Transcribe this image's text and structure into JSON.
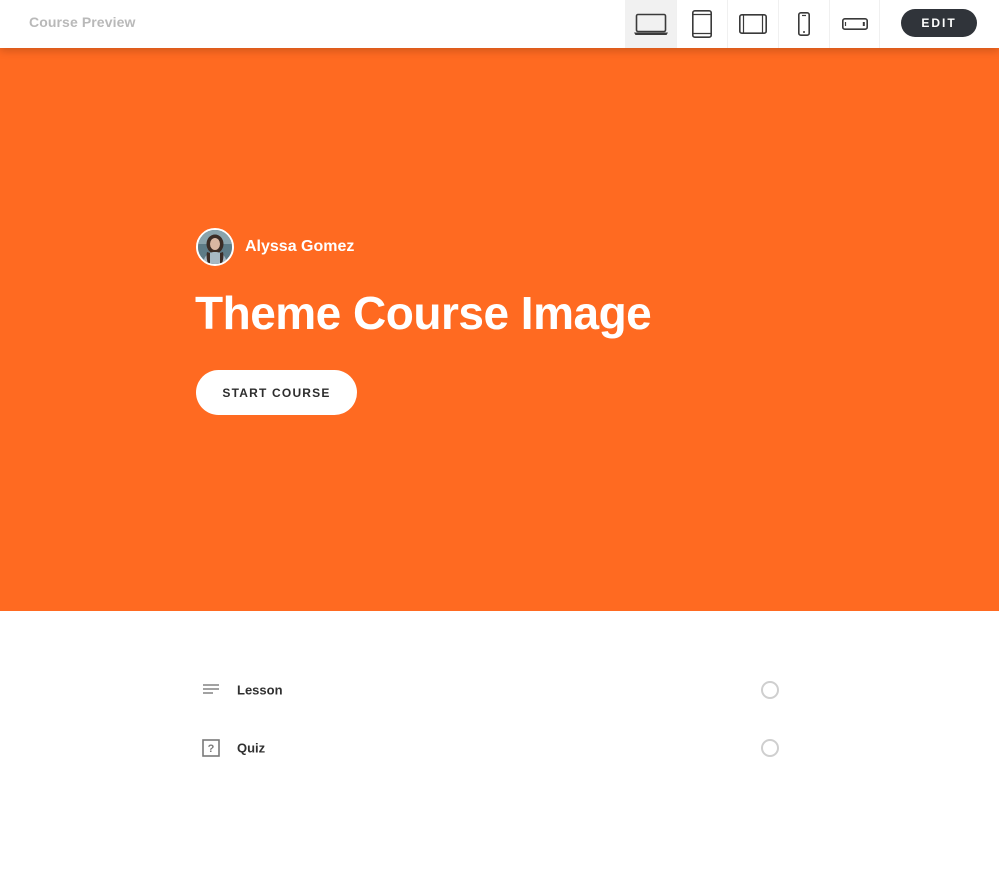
{
  "topbar": {
    "title": "Course Preview",
    "devices": [
      {
        "icon": "laptop-icon",
        "active": true
      },
      {
        "icon": "tablet-portrait-icon",
        "active": false
      },
      {
        "icon": "tablet-landscape-icon",
        "active": false
      },
      {
        "icon": "phone-portrait-icon",
        "active": false
      },
      {
        "icon": "phone-landscape-icon",
        "active": false
      }
    ],
    "edit_label": "EDIT"
  },
  "hero": {
    "background_color": "#ff6a21",
    "author_name": "Alyssa Gomez",
    "course_title": "Theme Course Image",
    "start_label": "START COURSE"
  },
  "outline": {
    "items": [
      {
        "label": "Lesson",
        "icon": "lesson-lines-icon"
      },
      {
        "label": "Quiz",
        "icon": "quiz-question-icon"
      }
    ]
  }
}
